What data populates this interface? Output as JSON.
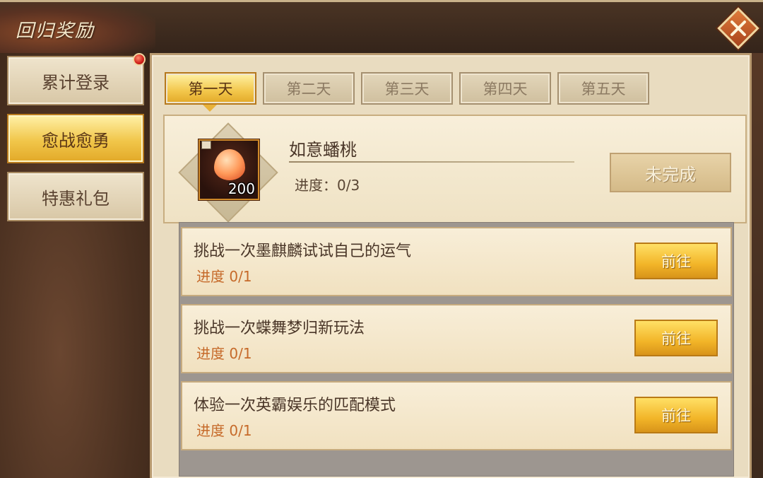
{
  "window": {
    "title": "回归奖励",
    "close_icon": "close-icon"
  },
  "sidebar": {
    "items": [
      {
        "label": "累计登录",
        "active": false,
        "has_badge": true
      },
      {
        "label": "愈战愈勇",
        "active": true,
        "has_badge": false
      },
      {
        "label": "特惠礼包",
        "active": false,
        "has_badge": false
      }
    ]
  },
  "days": {
    "tabs": [
      {
        "label": "第一天",
        "active": true
      },
      {
        "label": "第二天",
        "active": false
      },
      {
        "label": "第三天",
        "active": false
      },
      {
        "label": "第四天",
        "active": false
      },
      {
        "label": "第五天",
        "active": false
      }
    ]
  },
  "reward": {
    "name": "如意蟠桃",
    "progress": "进度：0/3",
    "item_count": "200",
    "status_label": "未完成"
  },
  "tasks": [
    {
      "title": "挑战一次墨麒麟试试自己的运气",
      "progress": "进度 0/1",
      "button": "前往"
    },
    {
      "title": "挑战一次蝶舞梦归新玩法",
      "progress": "进度 0/1",
      "button": "前往"
    },
    {
      "title": "体验一次英霸娱乐的匹配模式",
      "progress": "进度 0/1",
      "button": "前往"
    }
  ],
  "colors": {
    "accent_gold": "#f2c64a",
    "progress_orange": "#c66a2a",
    "panel_bg": "#e9dcc0"
  }
}
